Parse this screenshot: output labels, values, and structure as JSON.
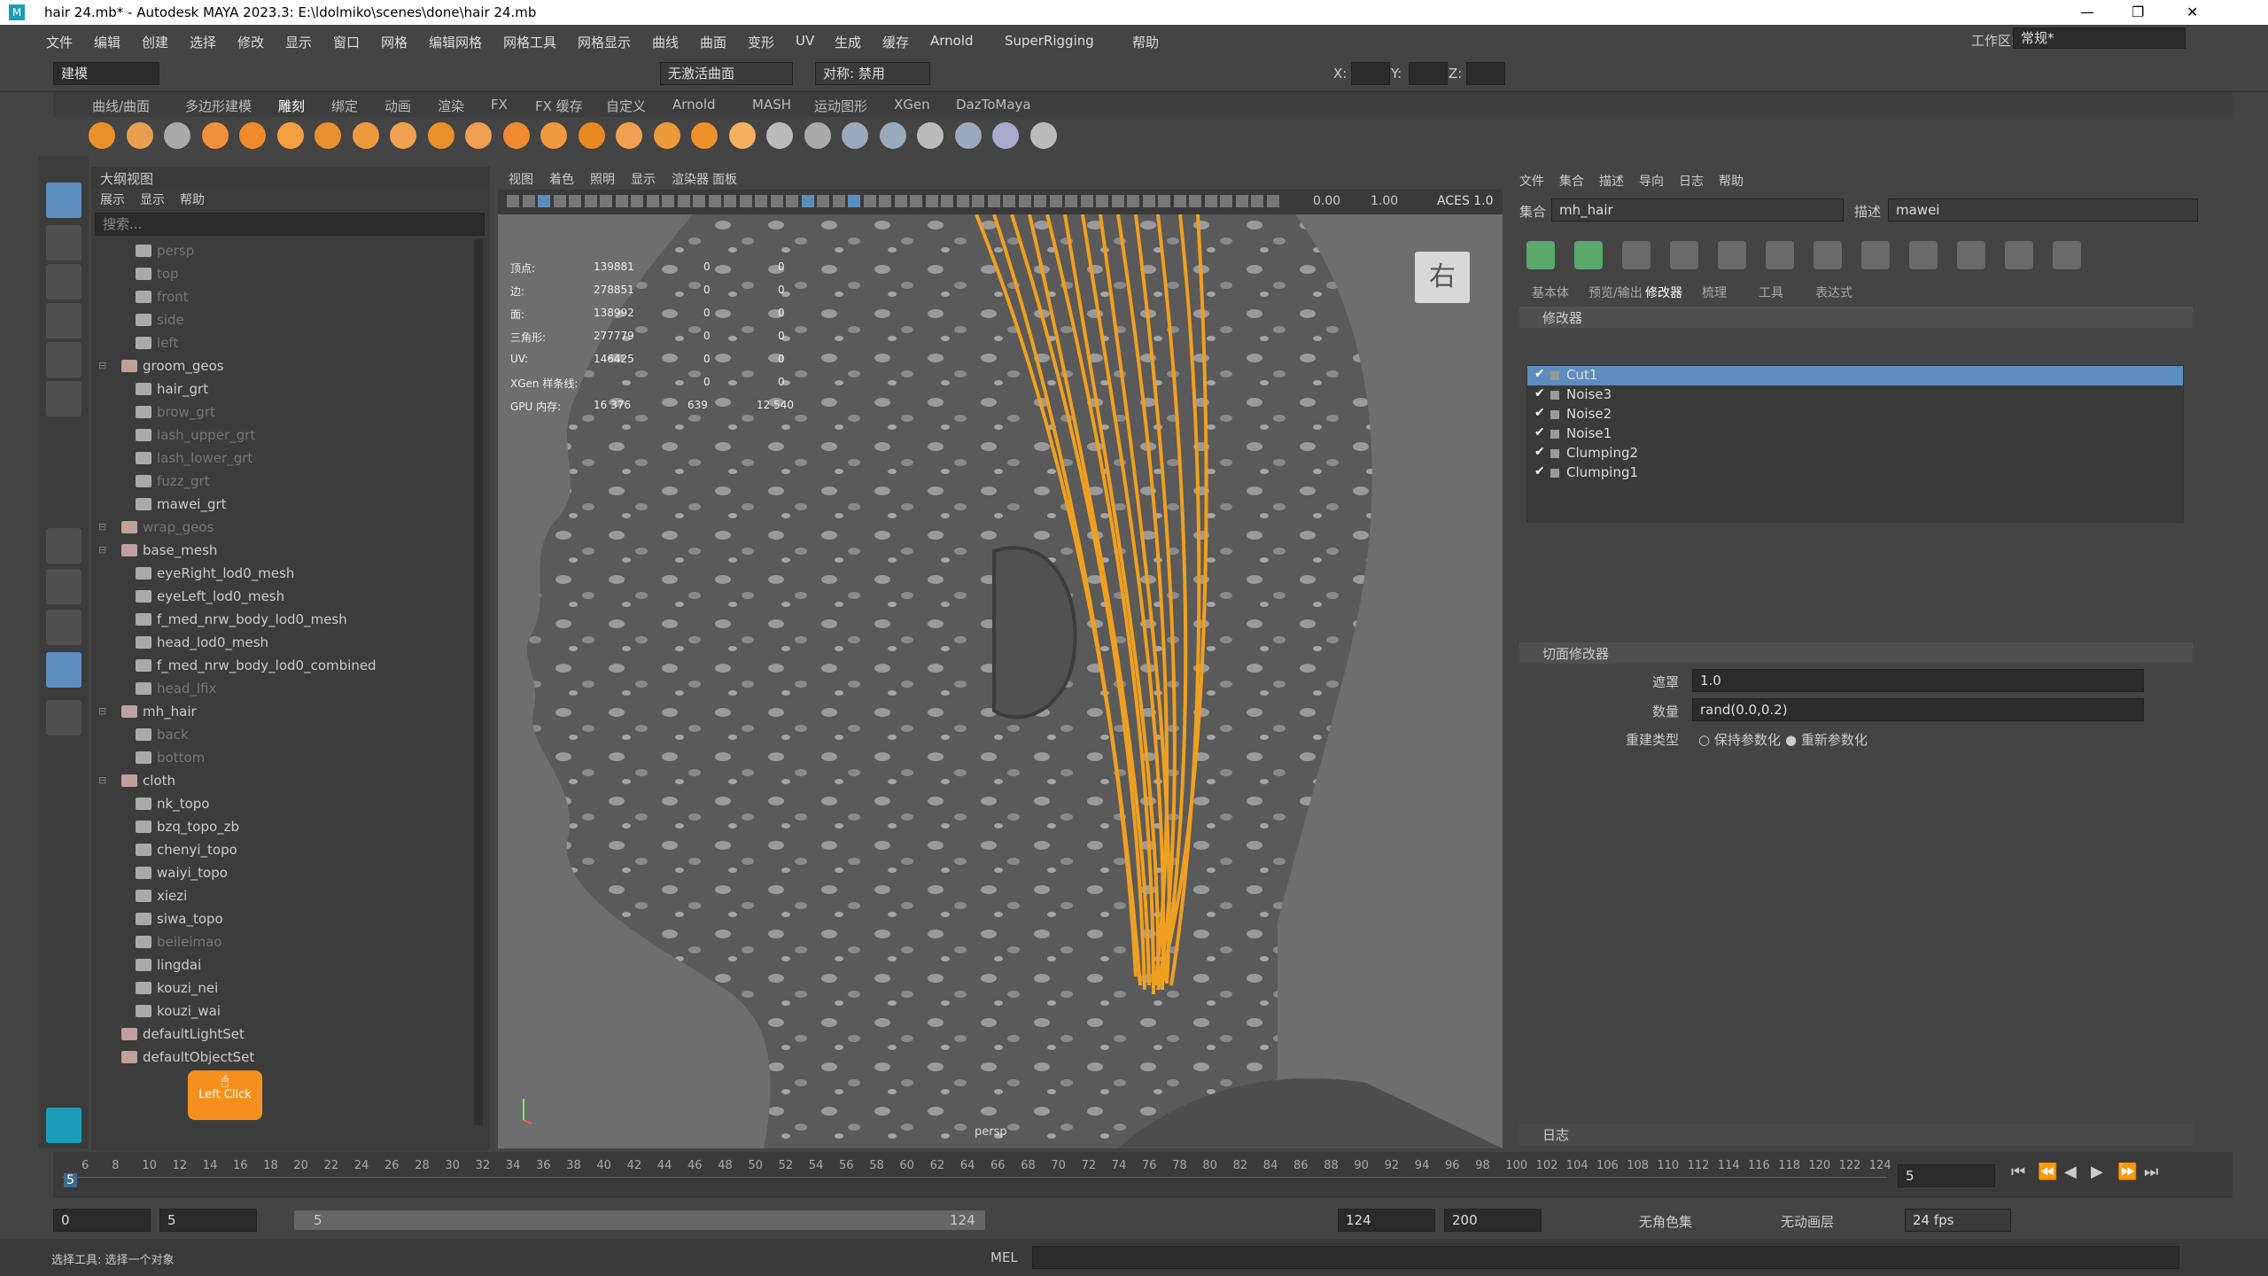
{
  "window": {
    "title": "hair 24.mb* - Autodesk MAYA 2023.3: E:\\ldolmiko\\scenes\\done\\hair 24.mb",
    "logo": "M"
  },
  "menubar": [
    "文件",
    "编辑",
    "创建",
    "选择",
    "修改",
    "显示",
    "窗口",
    "网格",
    "编辑网格",
    "网格工具",
    "网格显示",
    "曲线",
    "曲面",
    "变形",
    "UV",
    "生成",
    "缓存",
    "Arnold",
    "SuperRigging",
    "帮助"
  ],
  "workspace": {
    "label": "工作区:",
    "value": "常规*"
  },
  "status": {
    "mode": "建模",
    "curve": "无激活曲面",
    "symmetry": "对称: 禁用",
    "x_label": "X:",
    "y_label": "Y:",
    "z_label": "Z:"
  },
  "shelf_tabs": [
    "曲线/曲面",
    "多边形建模",
    "雕刻",
    "绑定",
    "动画",
    "渲染",
    "FX",
    "FX 缓存",
    "自定义",
    "Arnold",
    "MASH",
    "运动图形",
    "XGen",
    "DazToMaya"
  ],
  "shelf_active": "雕刻",
  "outliner": {
    "title": "大纲视图",
    "menu": [
      "展示",
      "显示",
      "帮助"
    ],
    "search": "搜索...",
    "items": [
      {
        "label": "persp",
        "indent": 1,
        "dim": true
      },
      {
        "label": "top",
        "indent": 1,
        "dim": true
      },
      {
        "label": "front",
        "indent": 1,
        "dim": true
      },
      {
        "label": "side",
        "indent": 1,
        "dim": true
      },
      {
        "label": "left",
        "indent": 1,
        "dim": true
      },
      {
        "label": "groom_geos",
        "indent": 0
      },
      {
        "label": "hair_grt",
        "indent": 1
      },
      {
        "label": "brow_grt",
        "indent": 1,
        "dim": true
      },
      {
        "label": "lash_upper_grt",
        "indent": 1,
        "dim": true
      },
      {
        "label": "lash_lower_grt",
        "indent": 1,
        "dim": true
      },
      {
        "label": "fuzz_grt",
        "indent": 1,
        "dim": true
      },
      {
        "label": "mawei_grt",
        "indent": 1
      },
      {
        "label": "wrap_geos",
        "indent": 0,
        "dim": true
      },
      {
        "label": "base_mesh",
        "indent": 0
      },
      {
        "label": "eyeRight_lod0_mesh",
        "indent": 1
      },
      {
        "label": "eyeLeft_lod0_mesh",
        "indent": 1
      },
      {
        "label": "f_med_nrw_body_lod0_mesh",
        "indent": 1
      },
      {
        "label": "head_lod0_mesh",
        "indent": 1
      },
      {
        "label": "f_med_nrw_body_lod0_combined",
        "indent": 1
      },
      {
        "label": "head_lfix",
        "indent": 1,
        "dim": true
      },
      {
        "label": "mh_hair",
        "indent": 0
      },
      {
        "label": "back",
        "indent": 1,
        "dim": true
      },
      {
        "label": "bottom",
        "indent": 1,
        "dim": true
      },
      {
        "label": "cloth",
        "indent": 0
      },
      {
        "label": "nk_topo",
        "indent": 1
      },
      {
        "label": "bzq_topo_zb",
        "indent": 1
      },
      {
        "label": "chenyi_topo",
        "indent": 1
      },
      {
        "label": "waiyi_topo",
        "indent": 1
      },
      {
        "label": "xiezi",
        "indent": 1
      },
      {
        "label": "siwa_topo",
        "indent": 1
      },
      {
        "label": "beileimao",
        "indent": 1,
        "dim": true
      },
      {
        "label": "lingdai",
        "indent": 1
      },
      {
        "label": "kouzi_nei",
        "indent": 1
      },
      {
        "label": "kouzi_wai",
        "indent": 1
      },
      {
        "label": "defaultLightSet",
        "indent": 0
      },
      {
        "label": "defaultObjectSet",
        "indent": 0
      }
    ]
  },
  "click_badge": "Left Click",
  "viewport": {
    "menu": [
      "视图",
      "着色",
      "照明",
      "显示",
      "渲染器",
      "面板"
    ],
    "exposure": "0.00",
    "gamma": "1.00",
    "colorspace": "ACES 1.0",
    "cube_label": "右",
    "camera": "persp",
    "hud": [
      {
        "label": "顶点:",
        "a": "139881",
        "b": "0",
        "c": "0"
      },
      {
        "label": "边:",
        "a": "278851",
        "b": "0",
        "c": "0"
      },
      {
        "label": "面:",
        "a": "138992",
        "b": "0",
        "c": "0"
      },
      {
        "label": "三角形:",
        "a": "277779",
        "b": "0",
        "c": "0"
      },
      {
        "label": "UV:",
        "a": "146425",
        "b": "0",
        "c": "0"
      },
      {
        "label": "XGen 样条线:",
        "a": "",
        "b": "0",
        "c": "0"
      },
      {
        "label": "GPU 内存:",
        "a": "16 376",
        "b": "639",
        "c": "12 540"
      }
    ]
  },
  "xgen": {
    "menu": [
      "文件",
      "集合",
      "描述",
      "导向",
      "日志",
      "帮助"
    ],
    "collection_label": "集合",
    "collection": "mh_hair",
    "description_label": "描述",
    "description": "mawei",
    "tabs": [
      "基本体",
      "预览/输出",
      "修改器",
      "梳理",
      "工具",
      "表达式"
    ],
    "active_tab": "修改器",
    "modifiers_header": "修改器",
    "modifiers": [
      "Cut1",
      "Noise3",
      "Noise2",
      "Noise1",
      "Clumping2",
      "Clumping1"
    ],
    "cut_header": "切面修改器",
    "mask_label": "遮罩",
    "mask_value": "1.0",
    "amount_label": "数量",
    "amount_value": "rand(0.0,0.2)",
    "rebuild_label": "重建类型",
    "opt1": "保持参数化",
    "opt2": "重新参数化",
    "log": "日志"
  },
  "timeline": {
    "ticks": [
      "6",
      "8",
      "10",
      "12",
      "14",
      "16",
      "18",
      "20",
      "22",
      "24",
      "26",
      "28",
      "30",
      "32",
      "34",
      "36",
      "38",
      "40",
      "42",
      "44",
      "46",
      "48",
      "50",
      "52",
      "54",
      "56",
      "58",
      "60",
      "62",
      "64",
      "66",
      "68",
      "70",
      "72",
      "74",
      "76",
      "78",
      "80",
      "82",
      "84",
      "86",
      "88",
      "90",
      "92",
      "94",
      "96",
      "98",
      "100",
      "102",
      "104",
      "106",
      "108",
      "110",
      "112",
      "114",
      "116",
      "118",
      "120",
      "122",
      "124"
    ],
    "current": "5",
    "current_field": "5"
  },
  "range": {
    "start": "0",
    "start2": "5",
    "slider_start": "5",
    "slider_end": "124",
    "end": "124",
    "end2": "200",
    "character": "无角色集",
    "layer": "无动画层",
    "fps": "24 fps"
  },
  "cmd": {
    "help": "选择工具: 选择一个对象",
    "lang": "MEL"
  },
  "colors": {
    "accent": "#5d8dbe",
    "hair": "#f0a020",
    "badge": "#f5901e"
  }
}
